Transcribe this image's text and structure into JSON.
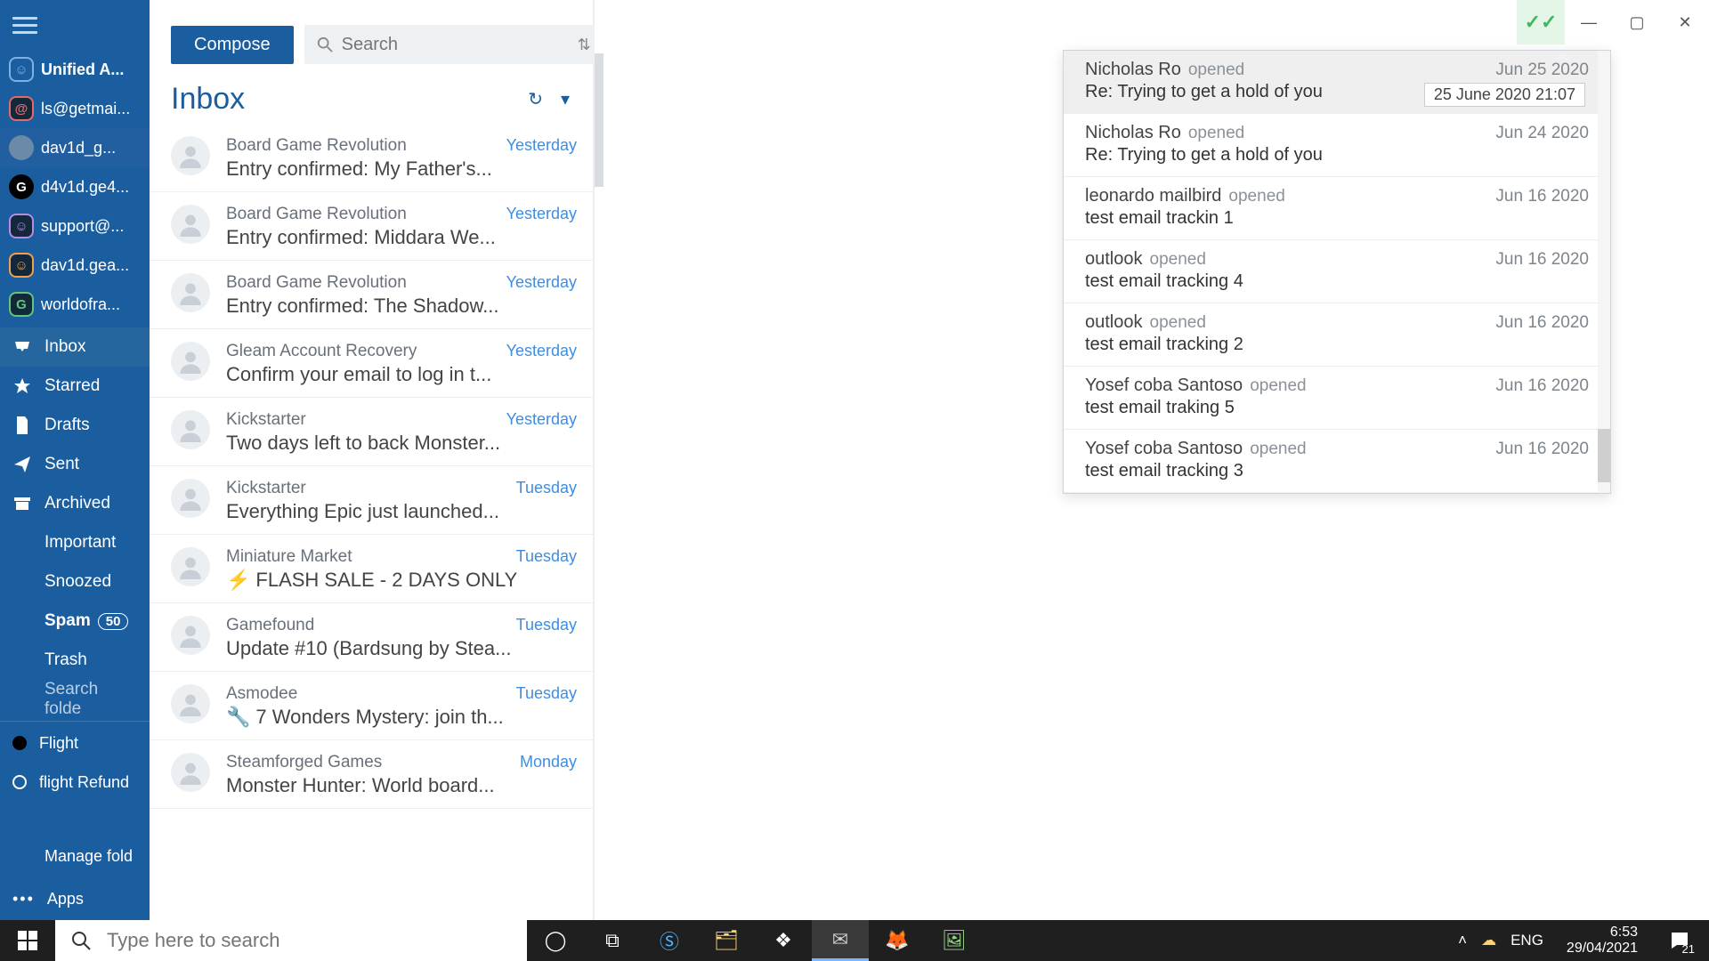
{
  "sidebar": {
    "accounts": [
      {
        "label": "Unified A...",
        "badge_class": "blue",
        "glyph": "☺",
        "bold": true
      },
      {
        "label": "ls@getmai...",
        "badge_class": "red",
        "glyph": "@"
      },
      {
        "label": "dav1d_g...",
        "badge_class": "photo",
        "glyph": "",
        "sel": true
      },
      {
        "label": "d4v1d.ge4...",
        "badge_class": "gdark",
        "glyph": "G"
      },
      {
        "label": "support@...",
        "badge_class": "violet",
        "glyph": "☺"
      },
      {
        "label": "dav1d.gea...",
        "badge_class": "orange",
        "glyph": "☺"
      },
      {
        "label": "worldofra...",
        "badge_class": "green",
        "glyph": "G"
      }
    ],
    "folders": {
      "inbox": "Inbox",
      "starred": "Starred",
      "drafts": "Drafts",
      "sent": "Sent",
      "archived": "Archived",
      "important": "Important",
      "snoozed": "Snoozed",
      "spam": "Spam",
      "spam_count": "50",
      "trash": "Trash",
      "search": "Search folde"
    },
    "tags": [
      {
        "label": "Flight",
        "filled": true
      },
      {
        "label": "flight Refund",
        "filled": false
      }
    ],
    "manage": "Manage fold",
    "apps": "Apps"
  },
  "toolbar": {
    "compose": "Compose",
    "search_placeholder": "Search"
  },
  "list": {
    "title": "Inbox",
    "items": [
      {
        "sender": "Board Game Revolution",
        "time": "Yesterday",
        "subject": "Entry confirmed: My Father's..."
      },
      {
        "sender": "Board Game Revolution",
        "time": "Yesterday",
        "subject": "Entry confirmed: Middara We..."
      },
      {
        "sender": "Board Game Revolution",
        "time": "Yesterday",
        "subject": "Entry confirmed: The Shadow..."
      },
      {
        "sender": "Gleam Account Recovery",
        "time": "Yesterday",
        "subject": "Confirm your email to log in t..."
      },
      {
        "sender": "Kickstarter",
        "time": "Yesterday",
        "subject": "Two days left to back Monster..."
      },
      {
        "sender": "Kickstarter",
        "time": "Tuesday",
        "subject": "Everything Epic just launched..."
      },
      {
        "sender": "Miniature Market",
        "time": "Tuesday",
        "subject": "FLASH SALE - 2 DAYS ONLY",
        "pre": "⚡"
      },
      {
        "sender": "Gamefound",
        "time": "Tuesday",
        "subject": "Update #10 (Bardsung by Stea..."
      },
      {
        "sender": "Asmodee",
        "time": "Tuesday",
        "subject": "7 Wonders Mystery: join th...",
        "pre": "🔧"
      },
      {
        "sender": "Steamforged Games",
        "time": "Monday",
        "subject": "Monster Hunter: World board..."
      }
    ]
  },
  "tracker": {
    "tooltip": "25 June 2020 21:07",
    "rows": [
      {
        "name": "Nicholas Ro",
        "status": "opened",
        "date": "Jun 25 2020",
        "subject": "Re: Trying to get a hold of you",
        "sel": true
      },
      {
        "name": "Nicholas Ro",
        "status": "opened",
        "date": "Jun 24 2020",
        "subject": "Re: Trying to get a hold of you"
      },
      {
        "name": "leonardo mailbird",
        "status": "opened",
        "date": "Jun 16 2020",
        "subject": "test email trackin 1"
      },
      {
        "name": "outlook",
        "status": "opened",
        "date": "Jun 16 2020",
        "subject": "test email tracking 4"
      },
      {
        "name": "outlook",
        "status": "opened",
        "date": "Jun 16 2020",
        "subject": "test email tracking 2"
      },
      {
        "name": "Yosef coba Santoso",
        "status": "opened",
        "date": "Jun 16 2020",
        "subject": "test email traking 5"
      },
      {
        "name": "Yosef coba Santoso",
        "status": "opened",
        "date": "Jun 16 2020",
        "subject": "test email tracking 3"
      }
    ]
  },
  "taskbar": {
    "search_placeholder": "Type here to search",
    "lang": "ENG",
    "time": "6:53",
    "date": "29/04/2021",
    "notif_count": "21"
  }
}
